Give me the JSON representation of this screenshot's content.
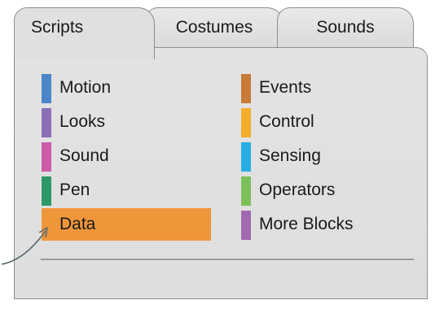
{
  "tabs": [
    {
      "label": "Scripts",
      "active": true
    },
    {
      "label": "Costumes",
      "active": false
    },
    {
      "label": "Sounds",
      "active": false
    }
  ],
  "categories_left": [
    {
      "label": "Motion",
      "color": "#4a86c8"
    },
    {
      "label": "Looks",
      "color": "#8a6fb8"
    },
    {
      "label": "Sound",
      "color": "#cc5ba8"
    },
    {
      "label": "Pen",
      "color": "#2e9968"
    },
    {
      "label": "Data",
      "color": "#f0963a",
      "selected": true
    }
  ],
  "categories_right": [
    {
      "label": "Events",
      "color": "#c87a38"
    },
    {
      "label": "Control",
      "color": "#f3ae2c"
    },
    {
      "label": "Sensing",
      "color": "#26aee3"
    },
    {
      "label": "Operators",
      "color": "#7cc05a"
    },
    {
      "label": "More Blocks",
      "color": "#a06ab0"
    }
  ],
  "colors": {
    "selected_highlight": "#f0963a",
    "panel_bg": "#e0e0e0",
    "border": "#8e8e8e",
    "arrow": "#5b6e72"
  }
}
